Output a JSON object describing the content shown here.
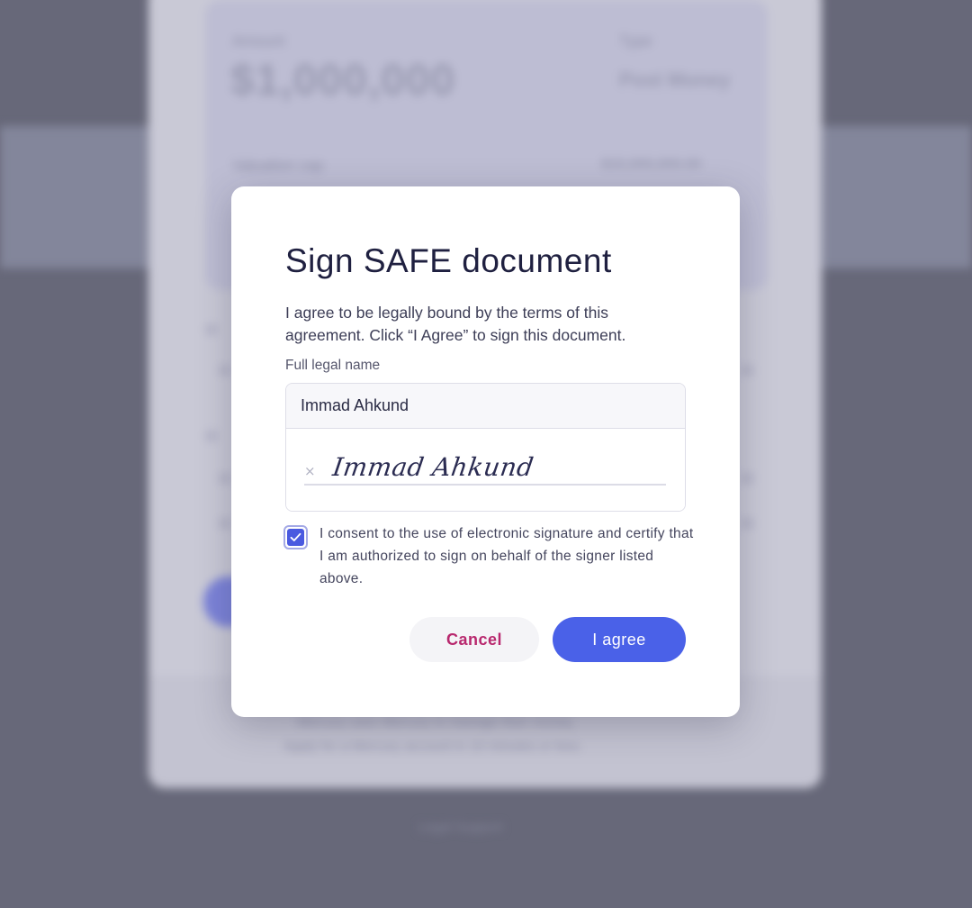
{
  "background": {
    "amount_label": "Amount",
    "amount": "$1,000,000",
    "type_label": "Type",
    "type_value": "Post Money",
    "valuation_label": "Valuation cap",
    "valuation_value": "$10,000,000.00",
    "footer_line1": "Mercury uses Mercury to manage their money.",
    "footer_line2": "Apply for a Mercury account in 10 minutes or less.",
    "footer_links": "Legal    Support"
  },
  "modal": {
    "title": "Sign SAFE document",
    "description": "I agree to be legally bound by the terms of this agreement. Click “I Agree” to sign this document.",
    "name_label": "Full legal name",
    "name_value": "Immad Ahkund",
    "signature_clear_glyph": "×",
    "signature_text": "Immad Ahkund",
    "consent_checked": true,
    "consent_text": "I consent to the use of electronic signature and certify that I am authorized to sign on behalf of the signer listed above.",
    "cancel_label": "Cancel",
    "agree_label": "I agree"
  },
  "colors": {
    "accent": "#4a61e8",
    "cancel_text": "#b8286e",
    "overlay": "#676879",
    "title": "#1f2040"
  },
  "icons": {
    "checkbox": "check-icon",
    "clear_signature": "close-icon"
  }
}
